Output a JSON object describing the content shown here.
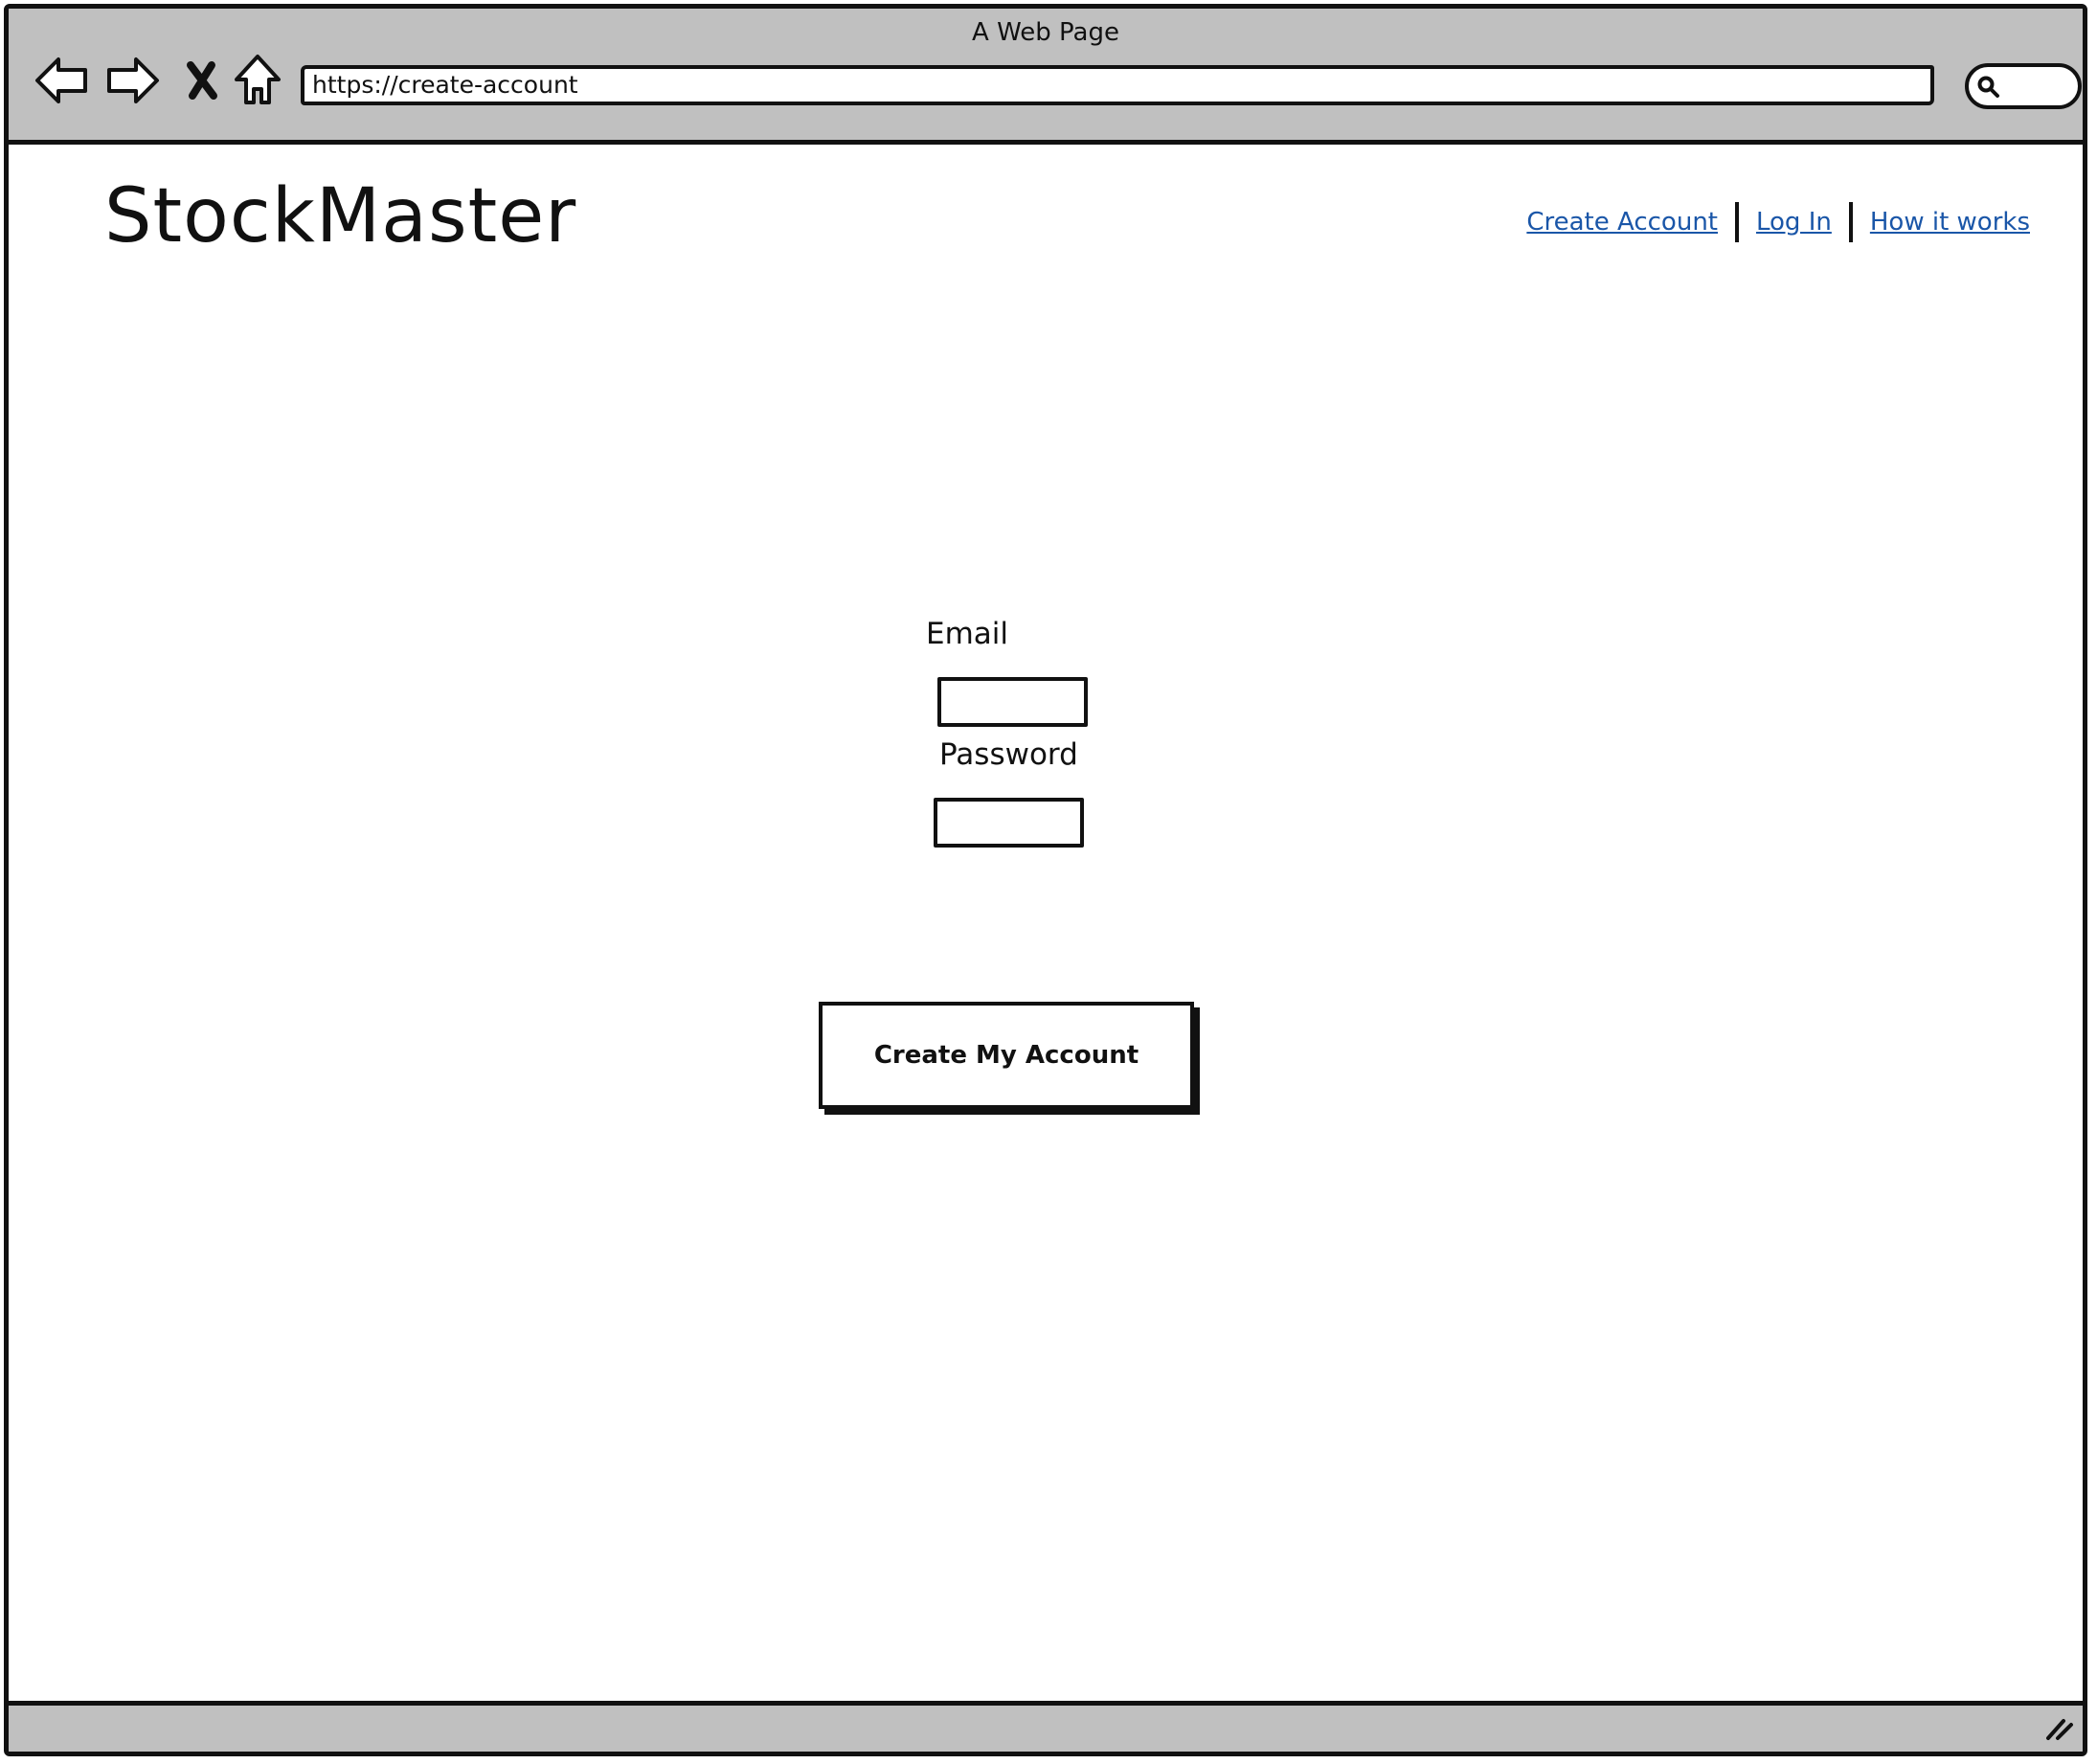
{
  "browser": {
    "window_title": "A Web Page",
    "url": "https://create-account",
    "icons": {
      "back": "back-arrow-icon",
      "forward": "forward-arrow-icon",
      "stop": "close-icon",
      "home": "home-icon",
      "search": "search-icon",
      "resize": "resize-grip-icon"
    }
  },
  "header": {
    "logo": "StockMaster",
    "links": [
      {
        "label": "Create Account"
      },
      {
        "label": "Log In"
      },
      {
        "label": "How it works"
      }
    ],
    "link_color": "#1a56a8"
  },
  "form": {
    "email_label": "Email",
    "email_value": "",
    "password_label": "Password",
    "password_value": "",
    "submit_label": "Create My Account"
  },
  "colors": {
    "chrome": "#c0c0c0",
    "stroke": "#111111",
    "background": "#ffffff"
  }
}
